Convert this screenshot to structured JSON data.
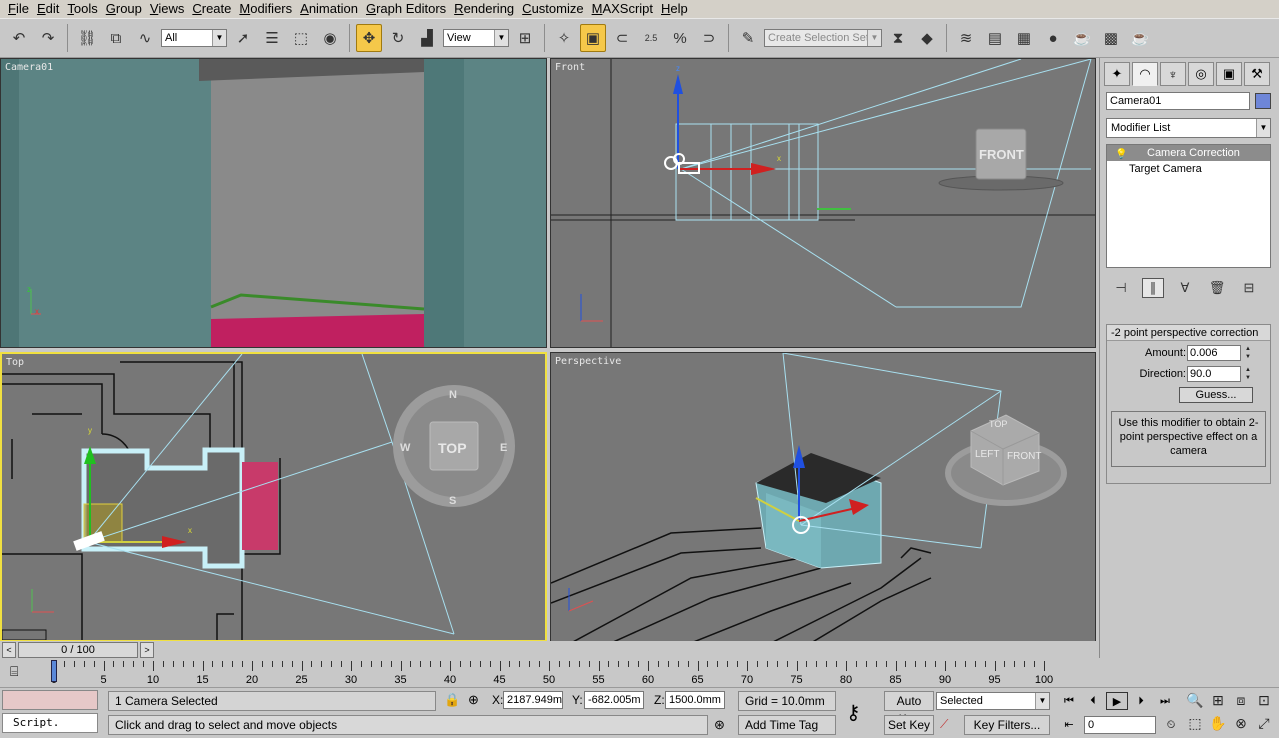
{
  "menubar": [
    "File",
    "Edit",
    "Tools",
    "Group",
    "Views",
    "Create",
    "Modifiers",
    "Animation",
    "Graph Editors",
    "Rendering",
    "Customize",
    "MAXScript",
    "Help"
  ],
  "toolbar": {
    "filter_value": "All",
    "coord_system_value": "View",
    "selection_set_placeholder": "Create Selection Set",
    "snap_angle_label": "2.5"
  },
  "viewports": {
    "camera": {
      "label": "Camera01"
    },
    "front": {
      "label": "Front",
      "cube_label": "FRONT"
    },
    "top": {
      "label": "Top",
      "cube_label": "TOP",
      "compass": [
        "N",
        "E",
        "S",
        "W"
      ]
    },
    "perspective": {
      "label": "Perspective",
      "cube_faces": [
        "TOP",
        "LEFT",
        "FRONT"
      ]
    }
  },
  "command_panel": {
    "object_name": "Camera01",
    "object_color": "#6e86d8",
    "modifier_list_label": "Modifier List",
    "stack": [
      {
        "label": "Camera Correction",
        "selected": true
      },
      {
        "label": "Target Camera",
        "selected": false
      }
    ],
    "rollout": {
      "title": "2 point perspective correction",
      "amount_label": "Amount:",
      "amount_value": "0.006",
      "direction_label": "Direction:",
      "direction_value": "90.0",
      "guess_label": "Guess...",
      "help_text": "Use this modifier to obtain 2-point perspective effect on a camera"
    }
  },
  "time_slider": {
    "label": "0 / 100"
  },
  "trackbar": {
    "ticks": [
      0,
      5,
      10,
      15,
      20,
      25,
      30,
      35,
      40,
      45,
      50,
      55,
      60,
      65,
      70,
      75,
      80,
      85,
      90,
      95,
      100
    ]
  },
  "status": {
    "maxscript_label": "Script.",
    "selection_info": "1 Camera Selected",
    "prompt": "Click and drag to select and move objects",
    "x_label": "X:",
    "x_value": "2187.949m",
    "y_label": "Y:",
    "y_value": "-682.005m",
    "z_label": "Z:",
    "z_value": "1500.0mm",
    "grid": "Grid = 10.0mm",
    "add_time_tag": "Add Time Tag",
    "auto_key": "Auto Key",
    "set_key": "Set Key",
    "key_mode_value": "Selected",
    "key_filters": "Key Filters...",
    "frame_value": "0"
  }
}
